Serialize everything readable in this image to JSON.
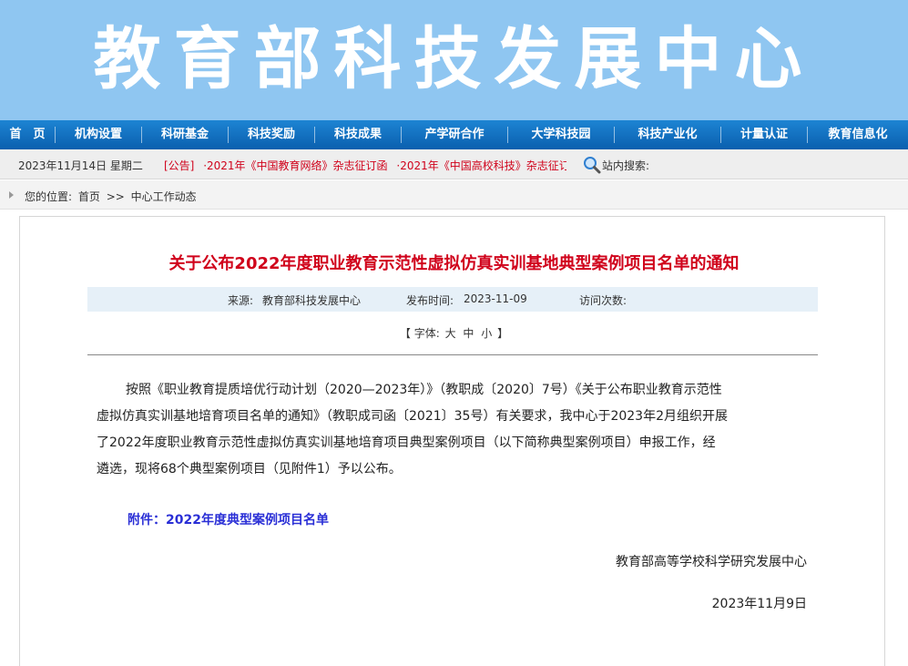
{
  "header": {
    "title": "教育部科技发展中心"
  },
  "nav": {
    "items": [
      {
        "label": "首　页"
      },
      {
        "label": "机构设置"
      },
      {
        "label": "科研基金"
      },
      {
        "label": "科技奖励"
      },
      {
        "label": "科技成果"
      },
      {
        "label": "产学研合作"
      },
      {
        "label": "大学科技园"
      },
      {
        "label": "科技产业化"
      },
      {
        "label": "计量认证"
      },
      {
        "label": "教育信息化"
      }
    ]
  },
  "infobar": {
    "date": "2023年11月14日 星期二",
    "notice_label": "[公告]",
    "notices": [
      "·2021年《中国教育网络》杂志征订函",
      "·2021年《中国高校科技》杂志征订"
    ],
    "search_label": "站内搜索:"
  },
  "breadcrumb": {
    "label": "您的位置:",
    "home": "首页",
    "sep": ">>",
    "current": "中心工作动态"
  },
  "article": {
    "title": "关于公布2022年度职业教育示范性虚拟仿真实训基地典型案例项目名单的通知",
    "source_label": "来源:",
    "source": "教育部科技发展中心",
    "publish_label": "发布时间:",
    "publish_date": "2023-11-09",
    "visits_label": "访问次数:",
    "font_open": "【 字体:",
    "font_large": "大",
    "font_medium": "中",
    "font_small": "小",
    "font_close": "】",
    "body_lines": [
      "按照《职业教育提质培优行动计划（2020—2023年）》（教职成〔2020〕7号）《关于公布职业教育示范性",
      "虚拟仿真实训基地培育项目名单的通知》（教职成司函〔2021〕35号）有关要求，我中心于2023年2月组织开展",
      "了2022年度职业教育示范性虚拟仿真实训基地培育项目典型案例项目（以下简称典型案例项目）申报工作，经",
      "遴选，现将68个典型案例项目（见附件1）予以公布。"
    ],
    "attachment": "附件：2022年度典型案例项目名单",
    "org": "教育部高等学校科学研究发展中心",
    "sign_date": "2023年11月9日"
  },
  "colors": {
    "banner": "#8fc6f1",
    "nav": "#0a5fae",
    "title_red": "#d0021b",
    "attachment_blue": "#2a2fd6"
  }
}
